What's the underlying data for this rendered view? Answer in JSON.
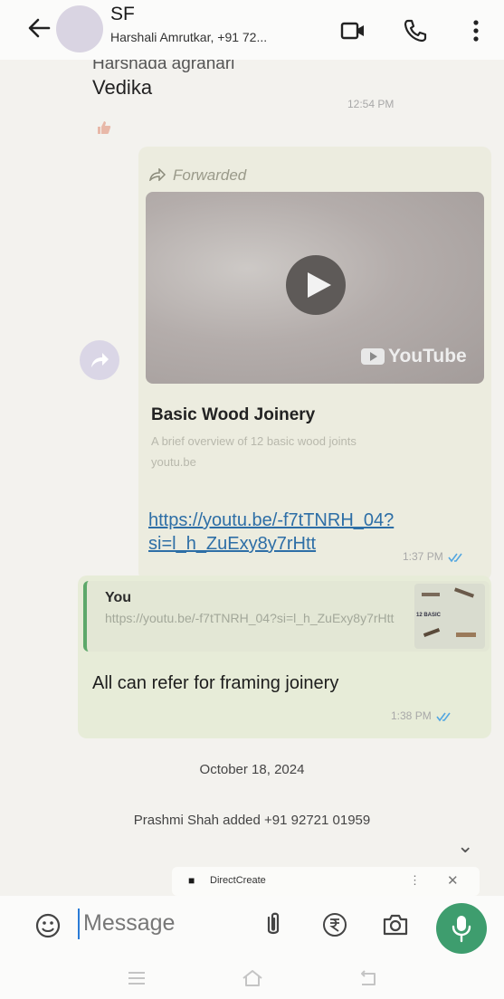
{
  "header": {
    "title": "SF",
    "subtitle": "Harshali Amrutkar, +91 72..."
  },
  "messages": {
    "cut_text": "Harshada agrahari",
    "vedika": "Vedika",
    "vedika_time": "12:54 PM",
    "forwarded_label": "Forwarded",
    "youtube_label": "YouTube",
    "link_preview": {
      "title": "Basic Wood Joinery",
      "description": "A brief overview of 12 basic wood joints",
      "host": "youtu.be"
    },
    "link_text": "https://youtu.be/-f7tTNRH_04?si=l_h_ZuExy8y7rHtt",
    "forward_time": "1:37 PM",
    "reply": {
      "quote_name": "You",
      "quote_text": "https://youtu.be/-f7tTNRH_04?si=l_h_ZuExy8y7rHtt",
      "thumb_label": "12 BASIC",
      "message": "All can refer for framing joinery",
      "time": "1:38 PM"
    },
    "date_chip": "October 18, 2024",
    "system_message": "Prashmi Shah added +91 92721 01959"
  },
  "toast": {
    "label": "DirectCreate"
  },
  "input": {
    "placeholder": "Message"
  },
  "colors": {
    "accent_green": "#3e9d6e",
    "link_blue": "#2d6ea6",
    "tick_blue": "#53a6e0"
  }
}
